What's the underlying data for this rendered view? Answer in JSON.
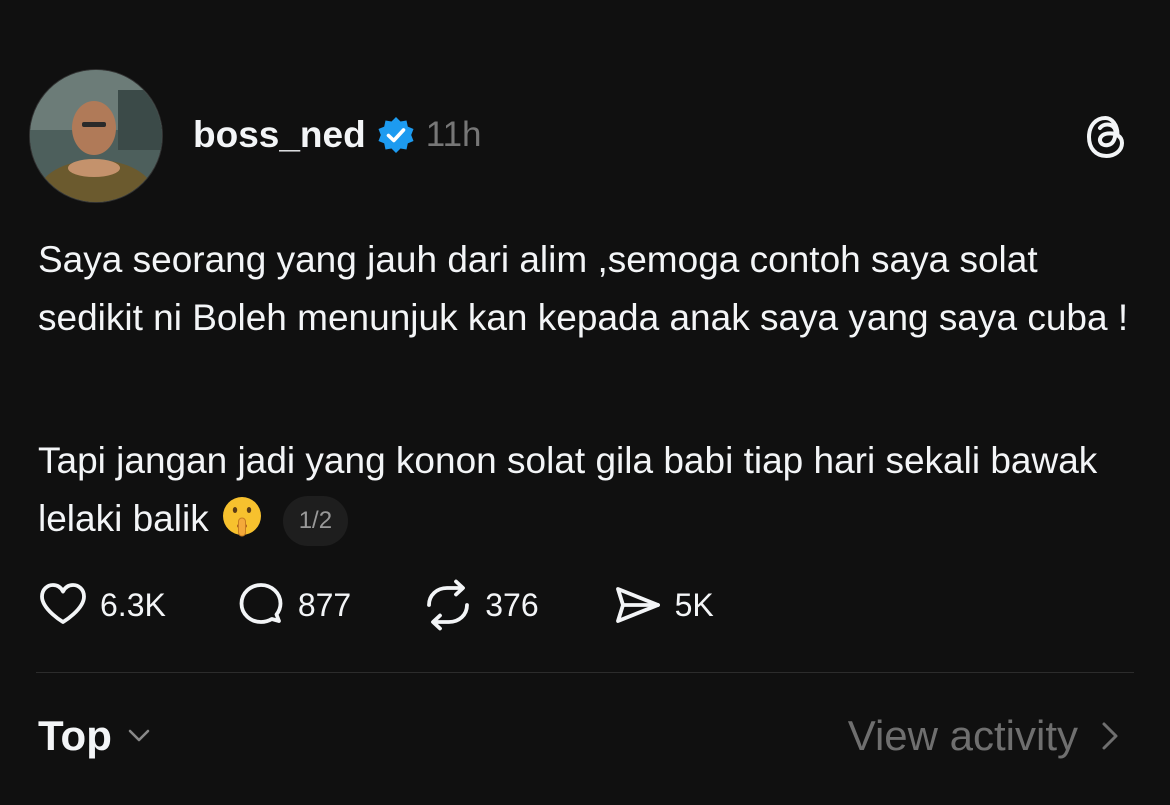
{
  "post": {
    "username": "boss_ned",
    "timestamp": "11h",
    "avatar_icon": "avatar-photo",
    "verified_icon": "verified-badge-icon",
    "app_icon": "threads-logo-icon",
    "paragraph1": "Saya seorang yang jauh dari alim ,semoga contoh saya solat sedikit ni Boleh menunjuk kan kepada anak saya yang saya cuba !",
    "paragraph2": "Tapi jangan jadi yang konon solat gila babi tiap hari sekali bawak lelaki balik",
    "emoji_icon": "shushing-face-emoji",
    "page_indicator": "1/2"
  },
  "actions": {
    "like": {
      "icon": "heart-icon",
      "count": "6.3K"
    },
    "comment": {
      "icon": "comment-icon",
      "count": "877"
    },
    "repost": {
      "icon": "repost-icon",
      "count": "376"
    },
    "share": {
      "icon": "send-icon",
      "count": "5K"
    }
  },
  "footer": {
    "sort_label": "Top",
    "view_activity_label": "View activity"
  },
  "colors": {
    "background": "#101010",
    "text": "#f3f5f7",
    "muted": "#777777",
    "verified": "#1d9bf0",
    "divider": "#2c2c2c"
  }
}
